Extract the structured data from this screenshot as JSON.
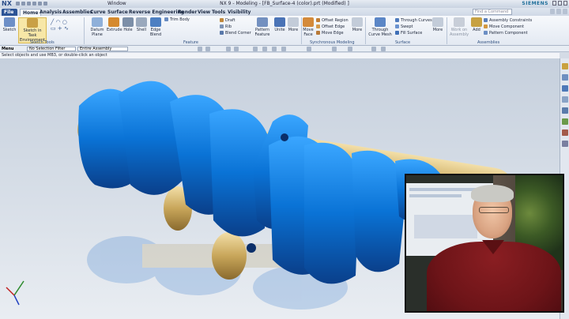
{
  "titlebar": {
    "logo": "NX",
    "window_menu": "Window",
    "title": "NX 9 - Modeling - [FB_Surface-4 (color).prt (Modified) ]",
    "brand": "SIEMENS"
  },
  "tabs": {
    "file": "File",
    "items": [
      "Home",
      "Analysis",
      "Assemblies",
      "Curve",
      "Surface",
      "Reverse Engineering",
      "Render",
      "View",
      "Tools",
      "Visibility"
    ],
    "search_placeholder": "Find a Command"
  },
  "ribbon": {
    "sketch": "Sketch",
    "sketch_in_task": "Sketch in Task Environment",
    "sketch_group": "Sketch Tools",
    "datum_plane": "Datum Plane",
    "extrude": "Extrude",
    "hole": "Hole",
    "shell": "Shell",
    "edge_blend": "Edge Blend",
    "trim_body": "Trim Body",
    "draft": "Draft",
    "rib": "Rib",
    "blend_corner": "Blend Corner",
    "pattern_feature": "Pattern Feature",
    "unite": "Unite",
    "more_feature": "More",
    "feature_group": "Feature",
    "move_face": "Move Face",
    "offset_region": "Offset Region",
    "offset_edge": "Offset Edge",
    "move_edge": "Move Edge",
    "more_sync": "More",
    "sync_group": "Synchronous Modeling",
    "through_curve_mesh": "Through Curve Mesh",
    "through_curves": "Through Curves",
    "swept": "Swept",
    "fill_surface": "Fill Surface",
    "more_surface": "More",
    "surface_group": "Surface",
    "work_on_assembly": "Work on Assembly",
    "add": "Add",
    "assembly_constraints": "Assembly Constraints",
    "move_component": "Move Component",
    "pattern_component": "Pattern Component",
    "assemblies_group": "Assemblies"
  },
  "selection_bar": {
    "menu": "Menu",
    "filter": "No Selection Filter",
    "scope": "Entire Assembly"
  },
  "status": "Select objects and use MB3, or double-click an object",
  "colors": {
    "part_blue": "#0a73d6",
    "bearing_gold": "#c8a65a",
    "accent": "#2c5496"
  }
}
